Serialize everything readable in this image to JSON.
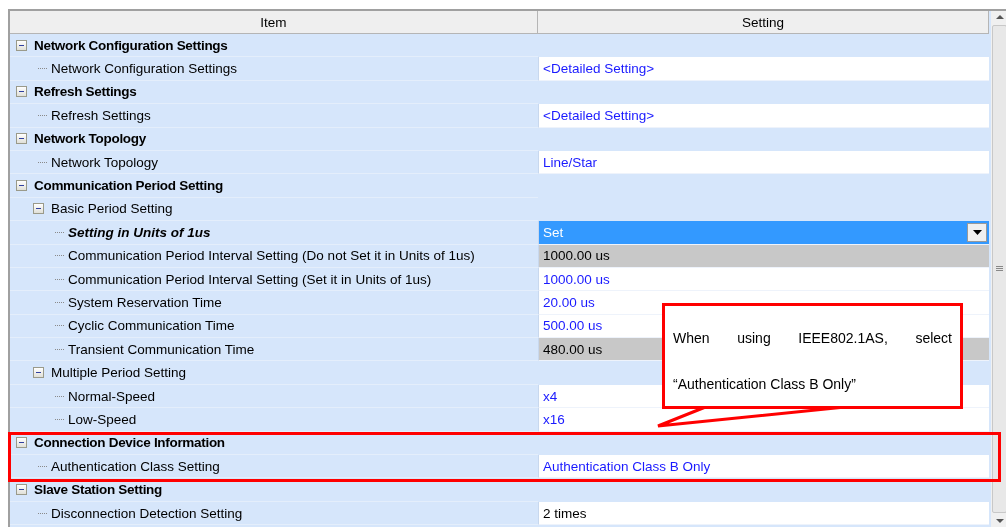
{
  "table": {
    "columns": [
      "Item",
      "Setting"
    ],
    "rows": [
      {
        "label": "Network Configuration Settings",
        "expanded": true,
        "children": [
          {
            "label": "Network Configuration Settings",
            "value": "<Detailed Setting>",
            "kind": "link"
          }
        ]
      },
      {
        "label": "Refresh Settings",
        "expanded": true,
        "children": [
          {
            "label": "Refresh Settings",
            "value": "<Detailed Setting>",
            "kind": "link"
          }
        ]
      },
      {
        "label": "Network Topology",
        "expanded": true,
        "children": [
          {
            "label": "Network Topology",
            "value": "Line/Star",
            "kind": "link"
          }
        ]
      },
      {
        "label": "Communication Period Setting",
        "expanded": true,
        "children": [
          {
            "label": "Basic Period Setting",
            "expanded": true,
            "children": [
              {
                "label": "Setting in Units of 1us",
                "value": "Set",
                "kind": "dropdown",
                "selected": true,
                "emphasized": true
              },
              {
                "label": "Communication Period Interval Setting (Do not Set it in Units of 1us)",
                "value": "1000.00 us",
                "kind": "disabled"
              },
              {
                "label": "Communication Period Interval Setting (Set it in Units of 1us)",
                "value": "1000.00 us",
                "kind": "link"
              },
              {
                "label": "System Reservation Time",
                "value": "20.00 us",
                "kind": "link"
              },
              {
                "label": "Cyclic Communication Time",
                "value": "500.00 us",
                "kind": "link"
              },
              {
                "label": "Transient Communication Time",
                "value": "480.00 us",
                "kind": "disabled"
              }
            ]
          },
          {
            "label": "Multiple Period Setting",
            "expanded": true,
            "children": [
              {
                "label": "Normal-Speed",
                "value": "x4",
                "kind": "link"
              },
              {
                "label": "Low-Speed",
                "value": "x16",
                "kind": "link"
              }
            ]
          }
        ]
      },
      {
        "label": "Connection Device Information",
        "expanded": true,
        "children": [
          {
            "label": "Authentication Class Setting",
            "value": "Authentication Class B Only",
            "kind": "link"
          }
        ]
      },
      {
        "label": "Slave Station Setting",
        "expanded": true,
        "children": [
          {
            "label": "Disconnection Detection Setting",
            "value": "2 times",
            "kind": "plain"
          }
        ]
      }
    ]
  },
  "callout": {
    "text": "When using IEEE802.1AS, select “Authentication Class B Only”"
  }
}
